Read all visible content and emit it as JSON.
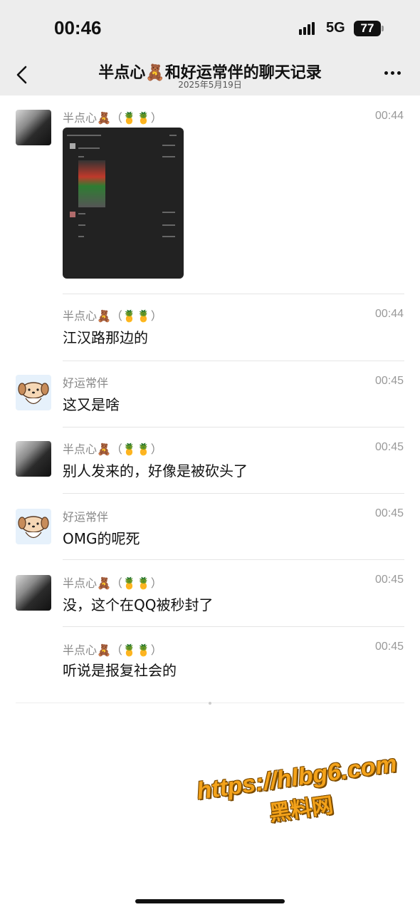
{
  "status_bar": {
    "time": "00:46",
    "network": "5G",
    "battery": "77"
  },
  "nav": {
    "title": "半点心🧸和好运常伴的聊天记录",
    "subtitle": "2025年5月19日"
  },
  "messages": [
    {
      "sender": "半点心🧸（🍍🍍）",
      "time": "00:44",
      "text": "",
      "type": "image",
      "avatar": "dark"
    },
    {
      "sender": "半点心🧸（🍍🍍）",
      "time": "00:44",
      "text": "江汉路那边的",
      "type": "text",
      "avatar": "none"
    },
    {
      "sender": "好运常伴",
      "time": "00:45",
      "text": "这又是啥",
      "type": "text",
      "avatar": "dog"
    },
    {
      "sender": "半点心🧸（🍍🍍）",
      "time": "00:45",
      "text": "别人发来的，好像是被砍头了",
      "type": "text",
      "avatar": "dark"
    },
    {
      "sender": "好运常伴",
      "time": "00:45",
      "text": "OMG的呢死",
      "type": "text",
      "avatar": "dog"
    },
    {
      "sender": "半点心🧸（🍍🍍）",
      "time": "00:45",
      "text": "没，这个在QQ被秒封了",
      "type": "text",
      "avatar": "dark"
    },
    {
      "sender": "半点心🧸（🍍🍍）",
      "time": "00:45",
      "text": "听说是报复社会的",
      "type": "text",
      "avatar": "none"
    }
  ],
  "watermark": {
    "url": "https://hlbg6.com",
    "name": "黑料网"
  }
}
